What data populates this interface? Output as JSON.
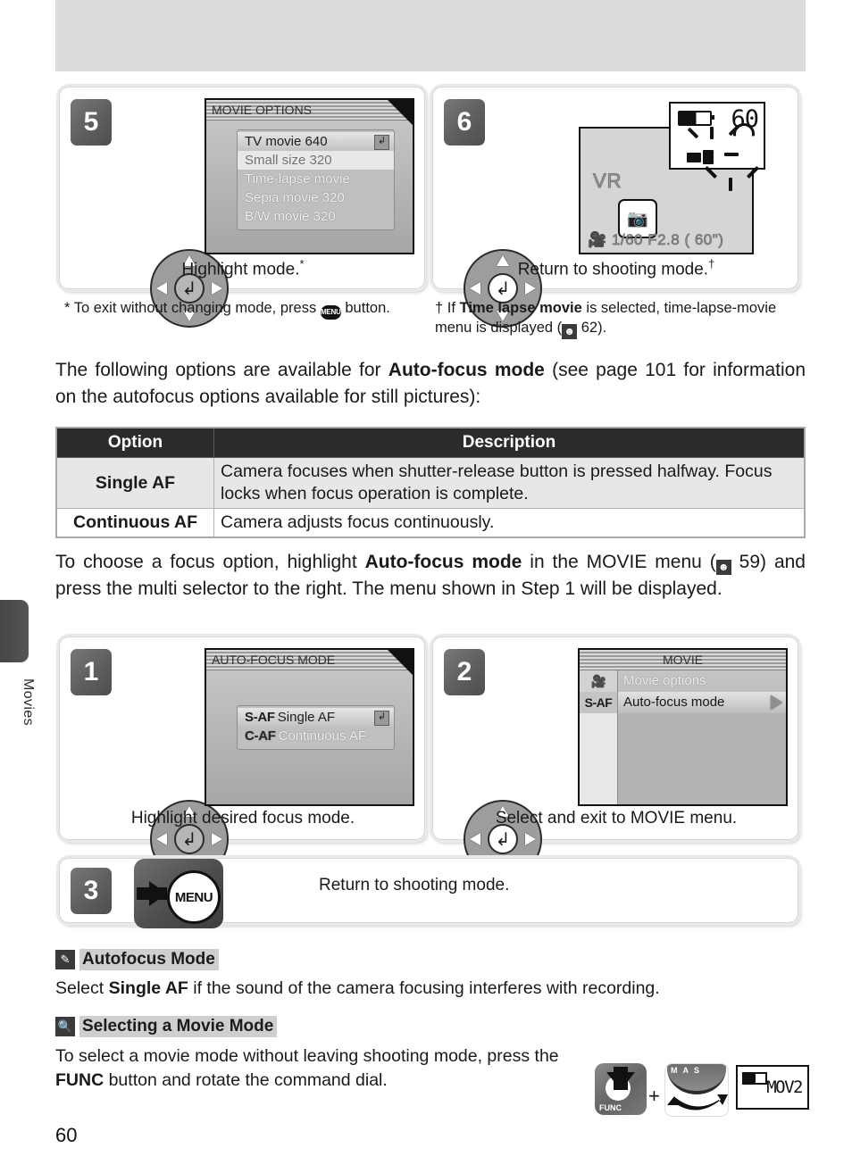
{
  "page": {
    "number": "60",
    "side_tab_label": "Movies"
  },
  "steps_top": [
    {
      "badge": "5",
      "caption": "Highlight mode.",
      "caption_marker": "*",
      "screen": {
        "title": "MOVIE OPTIONS",
        "items": [
          {
            "label": "TV movie 640",
            "state": "selected",
            "enter_icon": "enter-icon"
          },
          {
            "label": "Small size 320",
            "state": "highlighted"
          },
          {
            "label": "Time-lapse movie",
            "state": "normal"
          },
          {
            "label": "Sepia movie 320",
            "state": "normal"
          },
          {
            "label": "B/W movie 320",
            "state": "normal"
          }
        ]
      }
    },
    {
      "badge": "6",
      "caption": "Return to shooting mode.",
      "caption_marker": "†",
      "lcd": {
        "vr_indicator": "VR",
        "status_line": "1/60   F2.8  (  60\")",
        "control_panel": {
          "frames_remaining": "60",
          "battery": "battery-icon"
        }
      }
    }
  ],
  "footnotes": [
    {
      "marker": "*",
      "text_before": "To exit without changing mode, press ",
      "icon": "MENU",
      "text_after": " button."
    },
    {
      "marker": "†",
      "text_before": "If ",
      "bold": "Time lapse movie",
      "text_mid": " is selected, time-lapse-movie menu is displayed (",
      "ref_icon": "page-ref-icon",
      "ref_page": " 62).",
      "text_after": ""
    }
  ],
  "intro_paragraph": {
    "part1": "The following options are available for ",
    "bold1": "Auto-focus mode",
    "part2": " (see page 101 for information on the autofocus options available for still pictures):"
  },
  "table": {
    "headers": [
      "Option",
      "Description"
    ],
    "rows": [
      {
        "option": "Single AF",
        "description": "Camera focuses when shutter-release button is pressed halfway.  Focus locks when focus operation is complete."
      },
      {
        "option": "Continuous AF",
        "description": "Camera adjusts focus continuously."
      }
    ]
  },
  "second_paragraph": {
    "part1": "To choose a focus option, highlight ",
    "bold1": "Auto-focus mode",
    "part2": " in the MOVIE menu (",
    "ref_icon": "page-ref-icon",
    "part3": " 59) and press the multi selector to the right.  The menu shown in Step 1 will be displayed."
  },
  "steps_bottom": [
    {
      "badge": "1",
      "caption": "Highlight desired focus mode.",
      "screen": {
        "title": "AUTO-FOCUS MODE",
        "items": [
          {
            "tag": "S-AF",
            "label": "Single AF",
            "state": "selected",
            "enter_icon": "enter-icon"
          },
          {
            "tag": "C-AF",
            "label": "Continuous AF",
            "state": "normal"
          }
        ]
      }
    },
    {
      "badge": "2",
      "caption": "Select and exit to MOVIE menu.",
      "screen": {
        "title": "MOVIE",
        "items": [
          {
            "tag": "movie-camera-icon",
            "label": "Movie options",
            "state": "normal"
          },
          {
            "tag": "S-AF",
            "label": "Auto-focus mode",
            "state": "selected",
            "arrow": "right-arrow-icon"
          }
        ]
      }
    },
    {
      "badge": "3",
      "caption": "Return to shooting mode.",
      "button_label": "MENU"
    }
  ],
  "notes": [
    {
      "icon": "pencil-icon",
      "title": "Autofocus Mode",
      "body_part1": "Select ",
      "body_bold": "Single AF",
      "body_part2": " if the sound of the camera focusing interferes with recording."
    },
    {
      "icon": "magnifier-icon",
      "title": "Selecting a Movie Mode",
      "body_part1": "To select a movie mode without leaving shooting mode, press the ",
      "body_bold": "FUNC",
      "body_part2": " button and rotate the command dial."
    }
  ],
  "func_illustration": {
    "func_label": "FUNC",
    "plus": "+",
    "dial_letters": "MAS",
    "lcd_text": "MOV2"
  }
}
